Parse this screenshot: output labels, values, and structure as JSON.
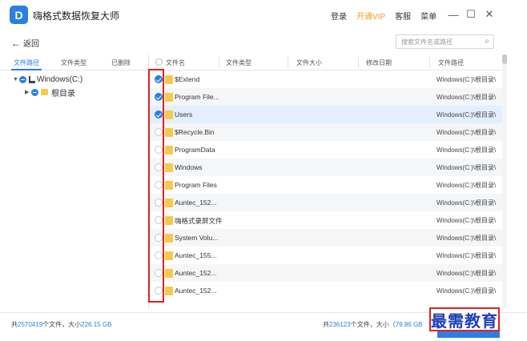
{
  "app": {
    "title": "嗨格式数据恢复大师",
    "logo": "D"
  },
  "header": {
    "login": "登录",
    "vip": "开通VIP",
    "service": "客服",
    "menu": "菜单"
  },
  "window_controls": {
    "minimize": "—",
    "maximize": "☐",
    "close": "✕"
  },
  "toolbar": {
    "back_label": "返回",
    "back_icon": "←",
    "search_placeholder": "搜索文件名或路径",
    "search_icon": "⌕"
  },
  "left_tabs": [
    "文件路径",
    "文件类型",
    "已删除"
  ],
  "tree": [
    {
      "label": "Windows(C:)",
      "expand": "▼"
    },
    {
      "label": "根目录",
      "expand": "▶"
    }
  ],
  "columns": [
    "文件名",
    "文件类型",
    "文件大小",
    "修改日期",
    "文件路径"
  ],
  "rows": [
    {
      "name": "$Extend",
      "path": "Windows(C:)\\根目录\\",
      "checked": true
    },
    {
      "name": "Program File...",
      "path": "Windows(C:)\\根目录\\",
      "checked": true
    },
    {
      "name": "Users",
      "path": "Windows(C:)\\根目录\\",
      "checked": true
    },
    {
      "name": "$Recycle.Bin",
      "path": "Windows(C:)\\根目录\\",
      "checked": false
    },
    {
      "name": "ProgramData",
      "path": "Windows(C:)\\根目录\\",
      "checked": false
    },
    {
      "name": "Windows",
      "path": "Windows(C:)\\根目录\\",
      "checked": false
    },
    {
      "name": "Program Files",
      "path": "Windows(C:)\\根目录\\",
      "checked": false
    },
    {
      "name": "Auntec_152...",
      "path": "Windows(C:)\\根目录\\",
      "checked": false
    },
    {
      "name": "嗨格式录屏文件",
      "path": "Windows(C:)\\根目录\\",
      "checked": false
    },
    {
      "name": "System Volu...",
      "path": "Windows(C:)\\根目录\\",
      "checked": false
    },
    {
      "name": "Auntec_155...",
      "path": "Windows(C:)\\根目录\\",
      "checked": false
    },
    {
      "name": "Auntec_152...",
      "path": "Windows(C:)\\根目录\\",
      "checked": false
    },
    {
      "name": "Auntec_152...",
      "path": "Windows(C:)\\根目录\\",
      "checked": false
    }
  ],
  "status_left": {
    "prefix": "共",
    "count": "2570419",
    "mid": "个文件，大小",
    "size": "226.15 GB"
  },
  "status_right": {
    "prefix": "共",
    "count": "236123",
    "mid": "个文件，大小（",
    "size": "79.86 GB"
  },
  "watermark": "最需教育",
  "colors": {
    "accent": "#2a7fe0",
    "vip": "#f0a020",
    "highlight": "#e02020"
  }
}
